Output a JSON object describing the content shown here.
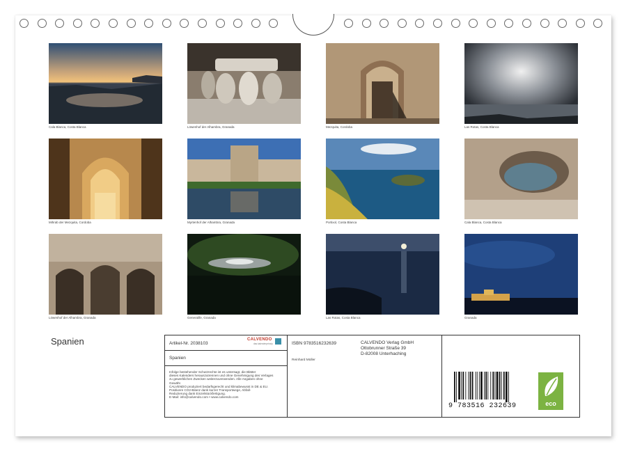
{
  "calendar_title": "Spanien",
  "photos": [
    {
      "caption": "Cala Blanca, Costa Blanca"
    },
    {
      "caption": "Löwenhof der Alhambra, Granada"
    },
    {
      "caption": "Mezquita, Cordoba"
    },
    {
      "caption": "Las Rotas, Costa Blanca"
    },
    {
      "caption": "Mihrab der Mezquita, Cordoba"
    },
    {
      "caption": "Myrtenhof der Alhambra, Granada"
    },
    {
      "caption": "Portixol, Costa Blanca"
    },
    {
      "caption": "Cala Blanca, Costa Blanca"
    },
    {
      "caption": "Löwenhof der Alhambra, Granada"
    },
    {
      "caption": "Generalife, Granada"
    },
    {
      "caption": "Las Rotas, Costa Blanca"
    },
    {
      "caption": "Granada"
    }
  ],
  "info": {
    "article_nr": "Artikel-Nr. 2038103",
    "brand": "CALVENDO",
    "brand_sub": "das kalenderprinzip",
    "product_title": "Spanien",
    "isbn": "ISBN 9783516232639",
    "author": "Reinhard Müller",
    "publisher_name": "CALVENDO Verlag GmbH",
    "publisher_street": "Ottobrunner Straße 39",
    "publisher_city": "D-82008 Unterhaching",
    "legal_1": "Infolge bestehender Schutzrechte ist es untersagt, die Blätter",
    "legal_2": "dieses Kalenders herauszutrennen und ohne Genehmigung des Verlages",
    "legal_3": "zu gewerblichen Zwecken weiterzuverwenden. Alle Angaben ohne",
    "legal_4": "Gewähr.",
    "legal_5": "CALVENDO produziert bedarfsgerecht und klimabewusst in DE & EU.",
    "legal_6": "Positivere CO2-Bilanz dank kurzer Transportwege, Abfall-",
    "legal_7": "Reduzierung dank Einzelstückfertigung.",
    "legal_8": "E-Mail: info@calvendo.com • www.calvendo.com",
    "barcode_digits": "9 783516 232639",
    "eco_label": "eco"
  },
  "colors": {
    "eco_green": "#7cb342",
    "brand_red": "#c0392b"
  }
}
